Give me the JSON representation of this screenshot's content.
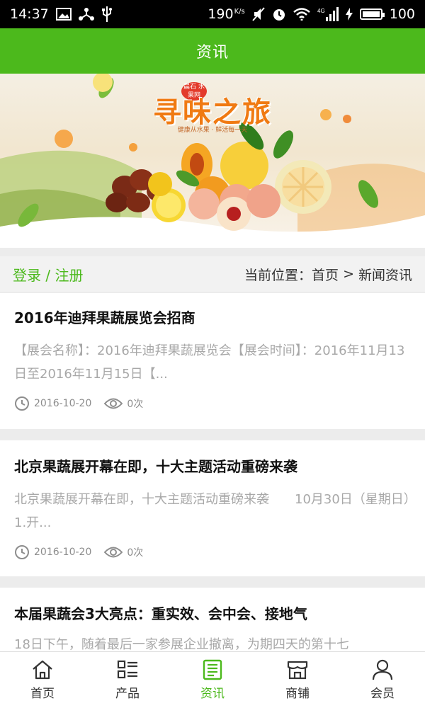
{
  "status_bar": {
    "time": "14:37",
    "speed": "190",
    "speed_unit": "K/s",
    "network": "4G",
    "battery": "100",
    "battery_fraction": 1.0
  },
  "header": {
    "title": "资讯"
  },
  "banner": {
    "title": "寻味之旅",
    "badge": "晨石 水果网",
    "subtitle": "健康从水果 · 鲜活每一天"
  },
  "crumb": {
    "login_label": "登录 / 注册",
    "location_label": "当前位置：",
    "home": "首页",
    "separator": ">",
    "current": "新闻资讯"
  },
  "news": [
    {
      "title": "2016年迪拜果蔬展览会招商",
      "desc": "【展会名称】：2016年迪拜果蔬展览会【展会时间】：2016年11月13日至2016年11月15日【...",
      "date": "2016-10-20",
      "views": "0次"
    },
    {
      "title": "北京果蔬展开幕在即，十大主题活动重磅来袭",
      "desc": "北京果蔬展开幕在即，十大主题活动重磅来袭　　10月30日（星期日）　　1.开...",
      "date": "2016-10-20",
      "views": "0次"
    },
    {
      "title": "本届果蔬会3大亮点：重实效、会中会、接地气",
      "desc": "18日下午，随着最后一家参展企业撤离，为期四天的第十七",
      "date": "",
      "views": ""
    }
  ],
  "bottom_nav": [
    {
      "label": "首页",
      "icon": "home-icon"
    },
    {
      "label": "产品",
      "icon": "grid-list-icon"
    },
    {
      "label": "资讯",
      "icon": "news-icon",
      "active": true
    },
    {
      "label": "商铺",
      "icon": "shop-icon"
    },
    {
      "label": "会员",
      "icon": "user-icon"
    }
  ],
  "colors": {
    "accent": "#4cb91c",
    "muted_text": "#a8a8a8"
  }
}
